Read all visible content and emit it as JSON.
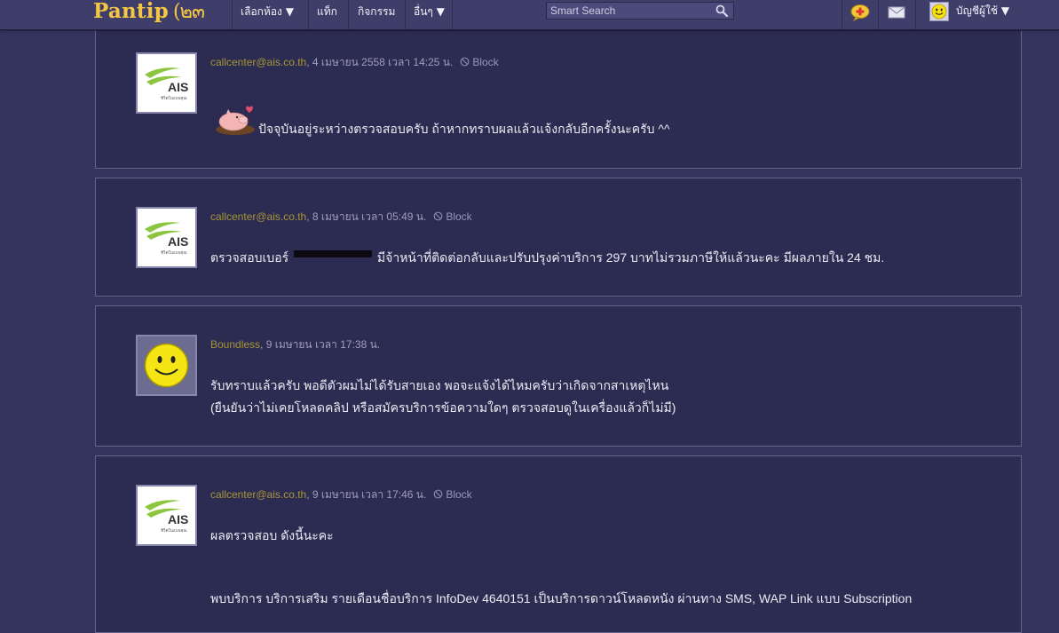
{
  "header": {
    "logo_text": "Pantip",
    "logo_mark": "(๒๓",
    "menu": [
      {
        "label": "เลือกห้อง ▼"
      },
      {
        "label": "แท็ก"
      },
      {
        "label": "กิจกรรม"
      },
      {
        "label": "อื่นๆ ▼"
      }
    ],
    "search_placeholder": "Smart Search",
    "account_label": "บัญชีผู้ใช้ ▼"
  },
  "ais_brand": {
    "name": "AIS",
    "tagline": "ชีวิตในแบบคุณ"
  },
  "posts": [
    {
      "author": "callcenter@ais.co.th",
      "date": ", 4 เมษายน 2558 เวลา 14:25 น.",
      "block_label": "Block",
      "lines": [
        "ปัจจุบันอยู่ระหว่างตรวจสอบครับ ถ้าหากทราบผลแล้วแจ้งกลับอีกครั้งนะครับ ^^"
      ]
    },
    {
      "author": "callcenter@ais.co.th",
      "date": ", 8 เมษายน เวลา 05:49 น.",
      "block_label": "Block",
      "text_before": "ตรวจสอบเบอร์",
      "text_after": "มีจ้าหน้าที่ติดต่อกลับและปรับปรุงค่าบริการ  297  บาทไม่รวมภาษีให้แล้วนะคะ มีผลภายใน 24 ชม."
    },
    {
      "author": "Boundless",
      "date": ", 9 เมษายน เวลา 17:38 น.",
      "lines": [
        "รับทราบแล้วครับ พอดีตัวผมไม่ได้รับสายเอง พอจะแจ้งได้ไหมครับว่าเกิดจากสาเหตุไหน",
        "(ยืนยันว่าไม่เคยโหลดคลิป หรือสมัครบริการข้อความใดๆ ตรวจสอบดูในเครื่องแล้วก็ไม่มี)"
      ]
    },
    {
      "author": "callcenter@ais.co.th",
      "date": ", 9 เมษายน เวลา 17:46 น.",
      "block_label": "Block",
      "lines": [
        "ผลตรวจสอบ ดังนี้นะคะ",
        "พบบริการ บริการเสริม รายเดือนชื่อบริการ InfoDev 4640151 เป็นบริการดาวน์โหลดหนัง ผ่านทาง SMS, WAP Link แบบ Subscription"
      ]
    }
  ]
}
